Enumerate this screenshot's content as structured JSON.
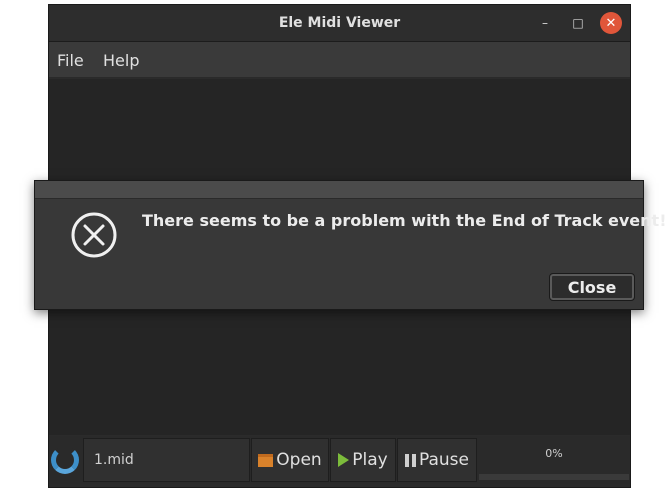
{
  "window": {
    "title": "Ele Midi Viewer",
    "minimize_glyph": "–",
    "maximize_glyph": "□",
    "close_glyph": "✕"
  },
  "menu": {
    "file": "File",
    "help": "Help"
  },
  "statusbar": {
    "filename": "1.mid",
    "open_label": "Open",
    "play_label": "Play",
    "pause_label": "Pause",
    "progress_text": "0%",
    "progress_value": 0
  },
  "dialog": {
    "message": "There seems to be a problem with the End of Track event!",
    "close_label": "Close",
    "icon": "error-circle-x-icon"
  },
  "colors": {
    "accent": "#3d8fc9",
    "close_window": "#e0563a",
    "play": "#7cbc3b",
    "open": "#d9822b"
  }
}
